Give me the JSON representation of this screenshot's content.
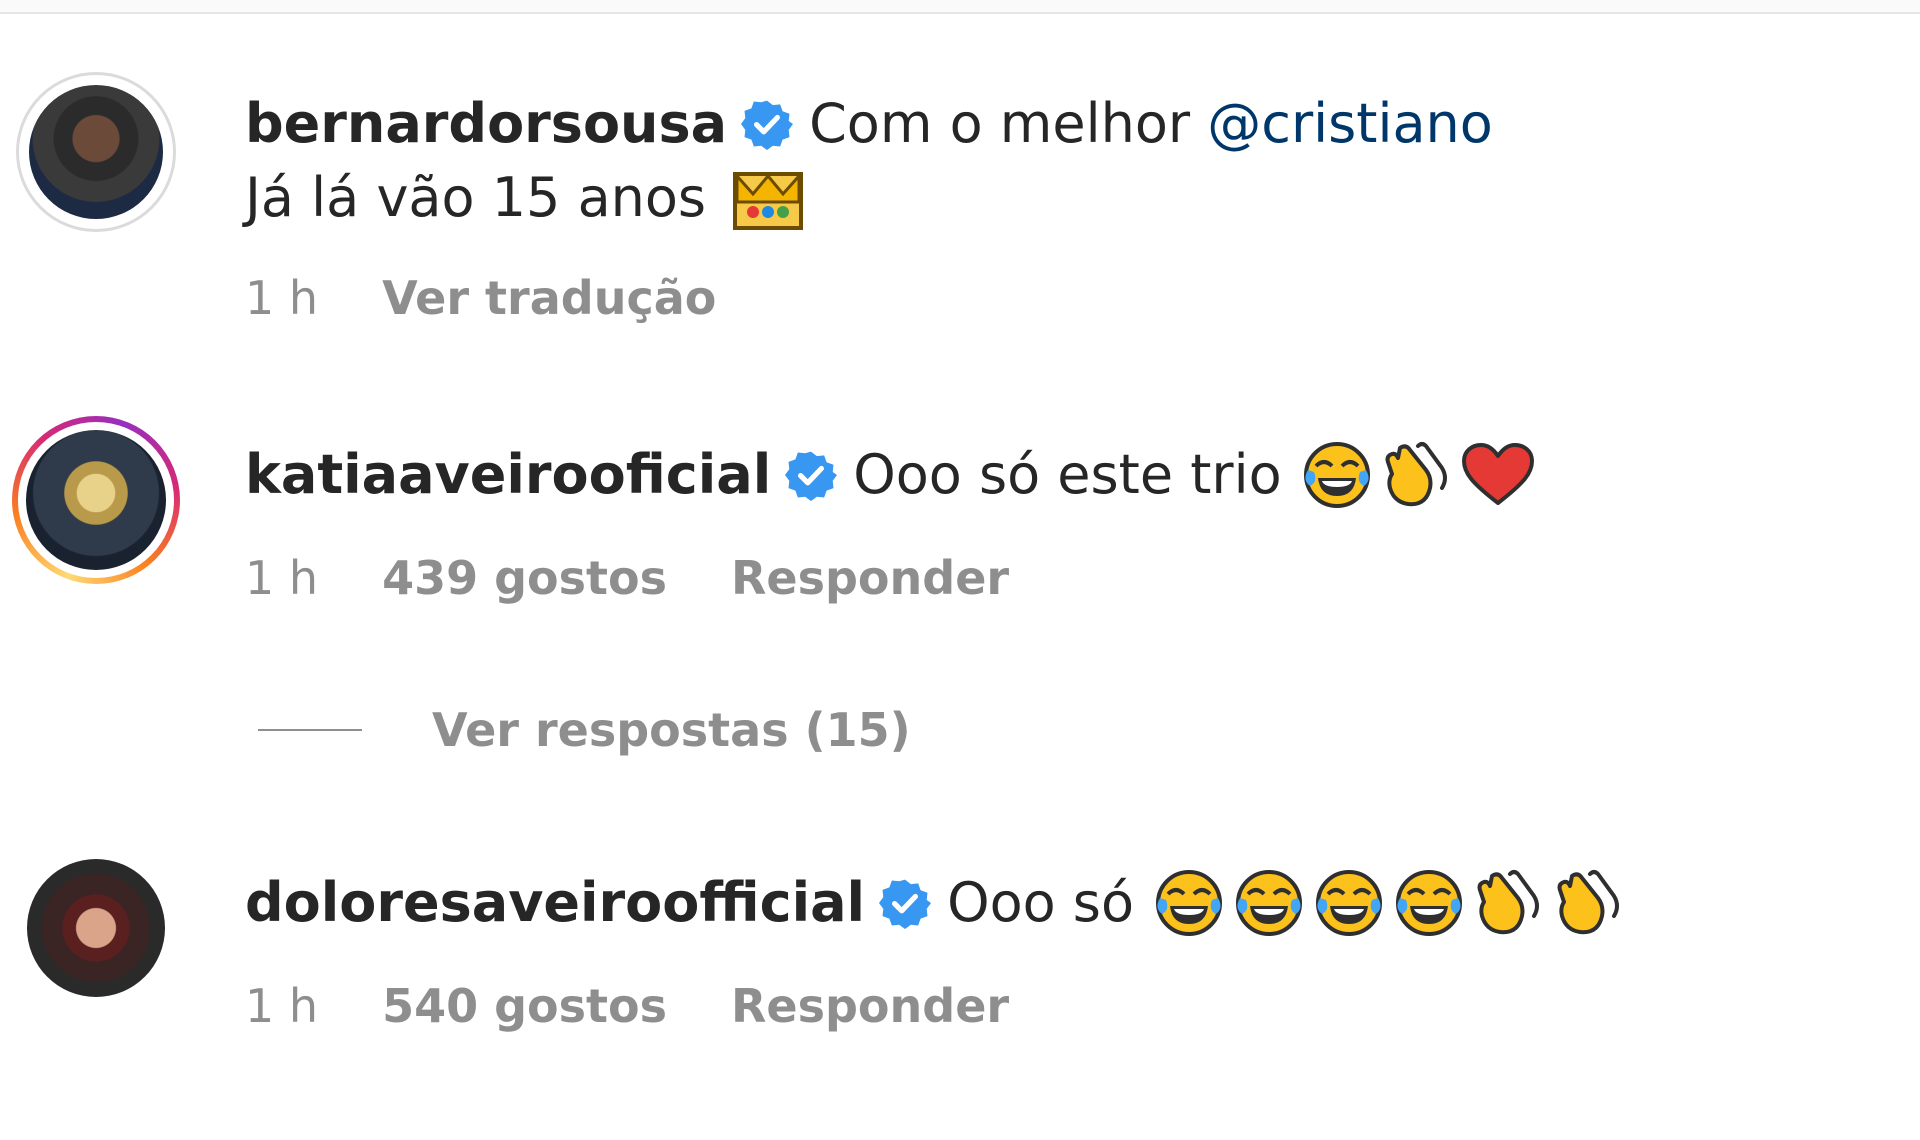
{
  "comments": [
    {
      "username": "bernardorsousa",
      "verified": true,
      "text": "Com o melhor ",
      "mention": "@cristiano",
      "text_line2": "Já lá vão 15 anos",
      "emojis_line2": [
        "crown-emoji"
      ],
      "time": "1 h",
      "likes": "",
      "action": "Ver tradução",
      "avatar_ring": "none"
    },
    {
      "username": "katiaaveirooficial",
      "verified": true,
      "text": "Ooo só este trio",
      "emojis": [
        "tears-of-joy-emoji",
        "clapping-hands-emoji",
        "red-heart-emoji"
      ],
      "time": "1 h",
      "likes": "439 gostos",
      "action": "Responder",
      "avatar_ring": "story",
      "view_replies": "Ver respostas (15)"
    },
    {
      "username": "doloresaveiroofficial",
      "verified": true,
      "text": "Ooo só",
      "emojis": [
        "tears-of-joy-emoji",
        "tears-of-joy-emoji",
        "tears-of-joy-emoji",
        "tears-of-joy-emoji",
        "clapping-hands-emoji",
        "clapping-hands-emoji"
      ],
      "time": "1 h",
      "likes": "540 gostos",
      "action": "Responder",
      "avatar_ring": "none"
    }
  ],
  "colors": {
    "text": "#262626",
    "secondary": "#8e8e8e",
    "mention": "#00376b",
    "verified": "#3897f0"
  }
}
